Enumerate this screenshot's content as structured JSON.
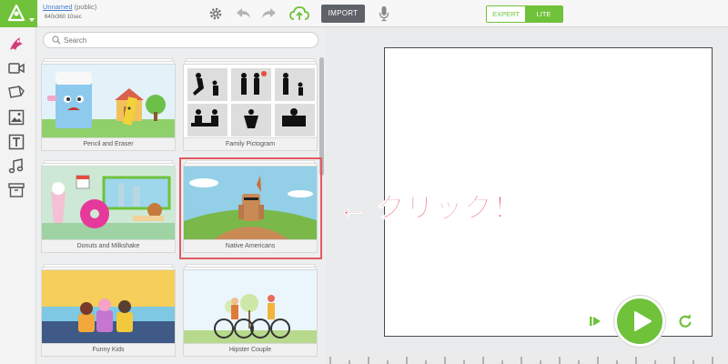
{
  "header": {
    "project_name": "Unnamed",
    "project_visibility": "(public)",
    "project_meta": "640x360  10sec",
    "import_label": "IMPORT",
    "mode_expert": "EXPERT",
    "mode_lite": "LITE"
  },
  "colors": {
    "brand_green": "#6fc23a",
    "selection_red": "#e15b61",
    "annotation_pink": "#e9656c"
  },
  "sidebar": {
    "items": [
      {
        "icon": "character-icon"
      },
      {
        "icon": "video-icon"
      },
      {
        "icon": "props-icon"
      },
      {
        "icon": "image-icon"
      },
      {
        "icon": "text-icon"
      },
      {
        "icon": "music-icon"
      },
      {
        "icon": "templates-icon"
      }
    ]
  },
  "search": {
    "placeholder": "Search"
  },
  "templates": [
    {
      "label": "Pencil and Eraser"
    },
    {
      "label": "Family Pictogram"
    },
    {
      "label": "Donuts and Milkshake"
    },
    {
      "label": "Native Americans"
    },
    {
      "label": "Funny Kids"
    },
    {
      "label": "Hipster Couple"
    }
  ],
  "annotation": "← クリック！"
}
